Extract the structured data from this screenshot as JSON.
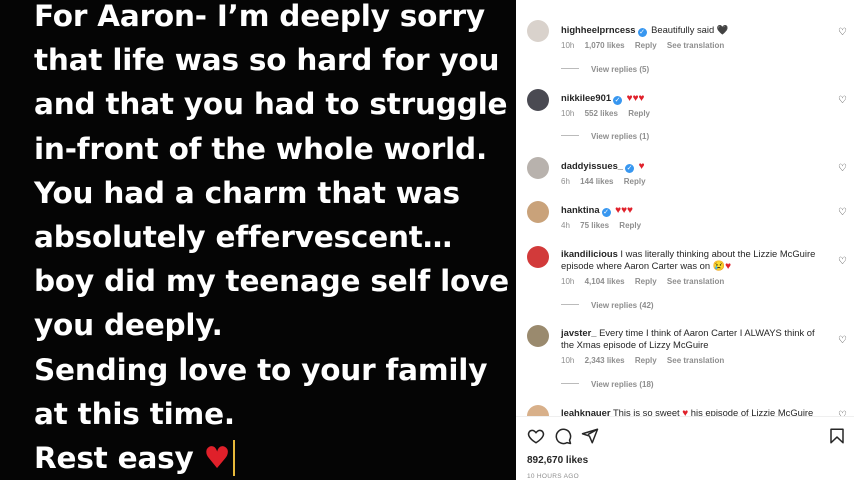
{
  "post": {
    "lines": [
      "For Aaron- I’m deeply sorry",
      "that life was so hard for you",
      "and that you had to struggle",
      "in-front of the whole world.",
      "You had a charm that was",
      "absolutely effervescent…",
      "boy did my teenage self love",
      "you deeply.",
      "Sending love to your family",
      "at this time.",
      "Rest easy"
    ],
    "end_emoji": "♥"
  },
  "comments": [
    {
      "user": "highheelprncess",
      "verified": true,
      "text": "Beautifully said",
      "emoji": "🖤",
      "time": "10h",
      "likes": "1,070 likes",
      "reply": "Reply",
      "translate": "See translation",
      "view_replies": "View replies (5)",
      "avatar_color": "#d9d2cc"
    },
    {
      "user": "nikkilee901",
      "verified": true,
      "text": "",
      "emoji": "♥♥♥",
      "time": "10h",
      "likes": "552 likes",
      "reply": "Reply",
      "translate": "",
      "view_replies": "View replies (1)",
      "avatar_color": "#4a4a52"
    },
    {
      "user": "daddyissues_",
      "verified": true,
      "text": "",
      "emoji": "♥",
      "time": "6h",
      "likes": "144 likes",
      "reply": "Reply",
      "translate": "",
      "view_replies": "",
      "avatar_color": "#b8b2ad"
    },
    {
      "user": "hanktina",
      "verified": true,
      "text": "",
      "emoji": "♥♥♥",
      "time": "4h",
      "likes": "75 likes",
      "reply": "Reply",
      "translate": "",
      "view_replies": "",
      "avatar_color": "#c9a27a"
    },
    {
      "user": "ikandilicious",
      "verified": false,
      "text": "I was literally thinking about the Lizzie McGuire episode where Aaron Carter was on",
      "emoji": "😢♥",
      "time": "10h",
      "likes": "4,104 likes",
      "reply": "Reply",
      "translate": "See translation",
      "view_replies": "View replies (42)",
      "avatar_color": "#d23a3a"
    },
    {
      "user": "javster_",
      "verified": false,
      "text": "Every time I think of Aaron Carter I ALWAYS think of the Xmas episode of Lizzy McGuire",
      "emoji": "",
      "time": "10h",
      "likes": "2,343 likes",
      "reply": "Reply",
      "translate": "See translation",
      "view_replies": "View replies (18)",
      "avatar_color": "#9a8a6e"
    },
    {
      "user": "leahknauer",
      "verified": false,
      "text": "This is so sweet",
      "emoji": "♥",
      "text2": "his episode of Lizzie McGuire",
      "time": "",
      "likes": "",
      "reply": "",
      "translate": "",
      "view_replies": "",
      "avatar_color": "#d8b08a"
    }
  ],
  "actions": {
    "likes": "892,670 likes",
    "time_ago": "10 HOURS AGO"
  },
  "icons": {
    "like": "heart-outline-icon",
    "comment": "comment-icon",
    "share": "share-icon",
    "save": "bookmark-icon",
    "comment_like": "small-heart-icon"
  }
}
